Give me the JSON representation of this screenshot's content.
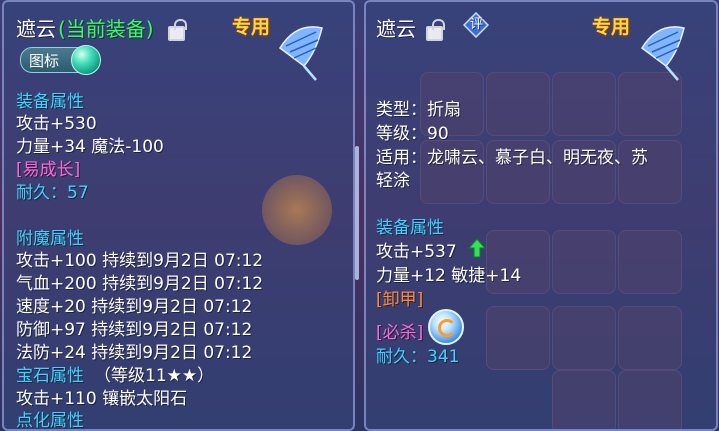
{
  "left": {
    "name": "遮云",
    "equipped_tag": "(当前装备)",
    "exclusive_badge": "专用",
    "icon_toggle_label": "图标",
    "equip_attr_header": "装备属性",
    "attack": "攻击+530",
    "stats": "力量+34 魔法-100",
    "special_tag": "[易成长]",
    "durability": "耐久：57",
    "enchant_header": "附魔属性",
    "enchant": [
      "攻击+100 持续到9月2日 07:12",
      "气血+200 持续到9月2日 07:12",
      "速度+20 持续到9月2日 07:12",
      "防御+97 持续到9月2日 07:12",
      "法防+24 持续到9月2日 07:12"
    ],
    "gem_header": "宝石属性",
    "gem_level": "（等级11★★）",
    "gem_detail": "攻击+110 镶嵌太阳石",
    "refine_header": "点化属性"
  },
  "right": {
    "name": "遮云",
    "eval_label": "评",
    "exclusive_badge": "专用",
    "type": "类型：折扇",
    "level": "等级：90",
    "usable_line1": "适用：龙啸云、慕子白、明无夜、苏",
    "usable_line2": "轻涂",
    "equip_attr_header": "装备属性",
    "attack": "攻击+537",
    "stats": "力量+12 敏捷+14",
    "special_tag": "[卸甲]",
    "skill_tag": "[必杀]",
    "durability": "耐久：341"
  },
  "colors": {
    "name": "#ffffff",
    "equipped": "#35ff5a",
    "header": "#3fd3ff",
    "tag": "#ff66d9",
    "exclusive": "#ffd54a"
  },
  "icons": [
    "lock-icon",
    "fan-weapon-icon",
    "gem-orb-icon",
    "evaluate-icon",
    "upgrade-arrow-icon",
    "critical-skill-icon"
  ]
}
